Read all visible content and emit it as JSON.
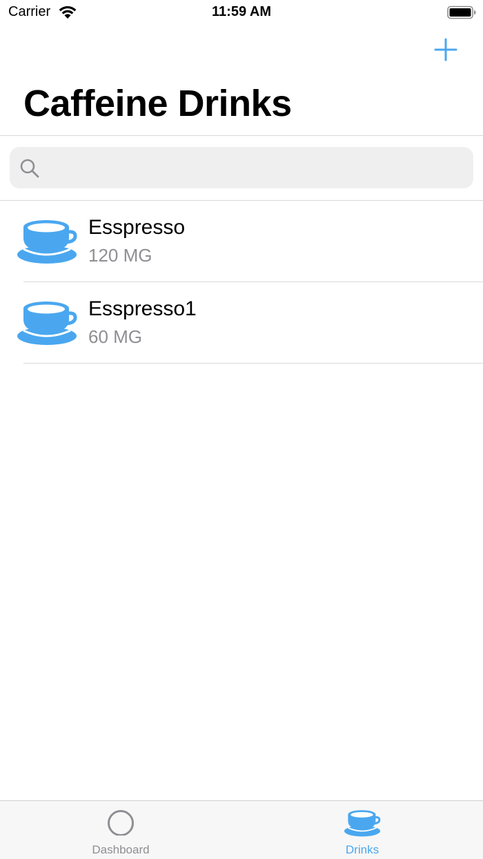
{
  "status_bar": {
    "carrier": "Carrier",
    "time": "11:59 AM",
    "icons": [
      "wifi-icon",
      "battery-icon"
    ]
  },
  "nav": {
    "title": "Caffeine Drinks",
    "add_icon": "plus-icon"
  },
  "search": {
    "placeholder": "",
    "value": "",
    "icon": "search-icon"
  },
  "drinks": [
    {
      "name": "Esspresso",
      "amount": "120 MG",
      "icon": "coffee-cup-icon"
    },
    {
      "name": "Esspresso1",
      "amount": "60 MG",
      "icon": "coffee-cup-icon"
    }
  ],
  "tabs": [
    {
      "label": "Dashboard",
      "icon": "circle-icon",
      "selected": false
    },
    {
      "label": "Drinks",
      "icon": "coffee-cup-icon",
      "selected": true
    }
  ],
  "colors": {
    "accent": "#4aa7ef",
    "inactive_tab": "#8e8e93",
    "secondary_text": "#8e8e93",
    "search_bg": "#efeff0"
  }
}
